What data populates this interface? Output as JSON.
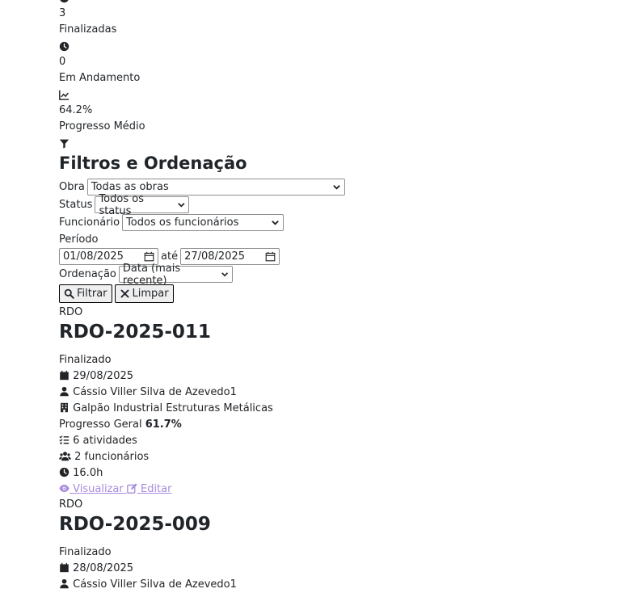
{
  "stats": [
    {
      "value": "3",
      "label": "Finalizadas",
      "icon": "check-circle-icon"
    },
    {
      "value": "0",
      "label": "Em Andamento",
      "icon": "clock-icon"
    },
    {
      "value": "64.2%",
      "label": "Progresso Médio",
      "icon": "chart-line-icon"
    }
  ],
  "filters": {
    "title": "Filtros e Ordenação",
    "obra_label": "Obra",
    "obra_value": "Todas as obras",
    "status_label": "Status",
    "status_value": "Todos os status",
    "funcionario_label": "Funcionário",
    "funcionario_value": "Todos os funcionários",
    "periodo_label": "Período",
    "date_from": "01/08/2025",
    "ate_label": "até",
    "date_to": "27/08/2025",
    "ordenacao_label": "Ordenação",
    "ordenacao_value": "Data (mais recente)",
    "filter_button": "Filtrar",
    "clear_button": "Limpar"
  },
  "rdos": [
    {
      "type_label": "RDO",
      "number": "RDO-2025-011",
      "status": "Finalizado",
      "date": "29/08/2025",
      "person": "Cássio Viller Silva de Azevedo1",
      "site": "Galpão Industrial Estruturas Metálicas",
      "progress_label": "Progresso Geral",
      "progress_value": "61.7%",
      "activities": "6 atividades",
      "workers": "2 funcionários",
      "hours": "16.0h",
      "view_link": "Visualizar",
      "edit_link": "Editar"
    },
    {
      "type_label": "RDO",
      "number": "RDO-2025-009",
      "status": "Finalizado",
      "date": "28/08/2025",
      "person": "Cássio Viller Silva de Azevedo1"
    }
  ]
}
